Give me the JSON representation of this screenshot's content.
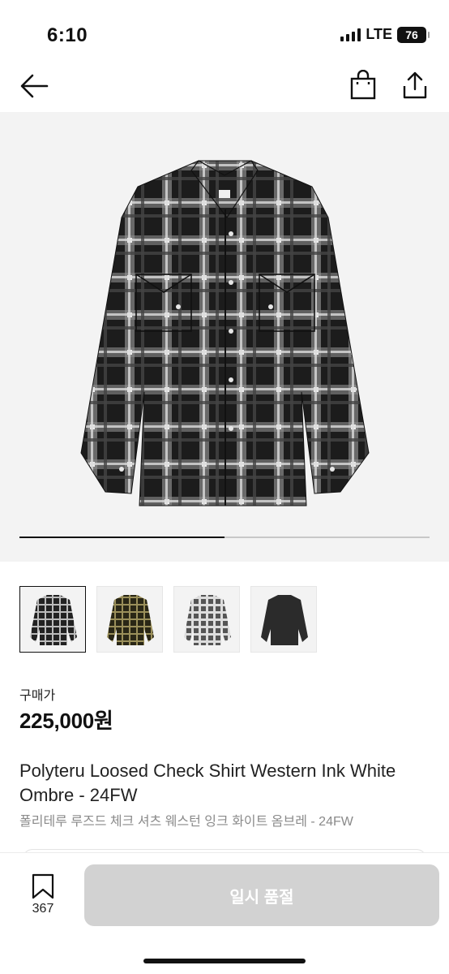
{
  "status_bar": {
    "time": "6:10",
    "network": "LTE",
    "battery": "76"
  },
  "nav": {
    "back_icon": "arrow-left-icon",
    "bag_icon": "shopping-bag-icon",
    "share_icon": "share-icon"
  },
  "gallery": {
    "current_index": 1,
    "total": 2,
    "progress_fraction": 0.5,
    "thumbnails": [
      {
        "label": "black-white-ombre-check",
        "selected": true
      },
      {
        "label": "olive-black-check",
        "selected": false
      },
      {
        "label": "grey-white-check",
        "selected": false
      },
      {
        "label": "solid-black",
        "selected": false
      }
    ]
  },
  "price": {
    "label": "구매가",
    "value": "225,000원"
  },
  "product": {
    "title_en": "Polyteru Loosed Check Shirt Western Ink White Ombre - 24FW",
    "title_ko": "폴리테루 루즈드 체크 셔츠 웨스턴 잉크 화이트 옴브레 - 24FW"
  },
  "bottom_bar": {
    "bookmark_count": "367",
    "buy_button_label": "일시 품절"
  },
  "colors": {
    "button_disabled": "#d2d2d2",
    "hero_background": "#f3f3f3",
    "text_muted": "#8a8a8a"
  }
}
